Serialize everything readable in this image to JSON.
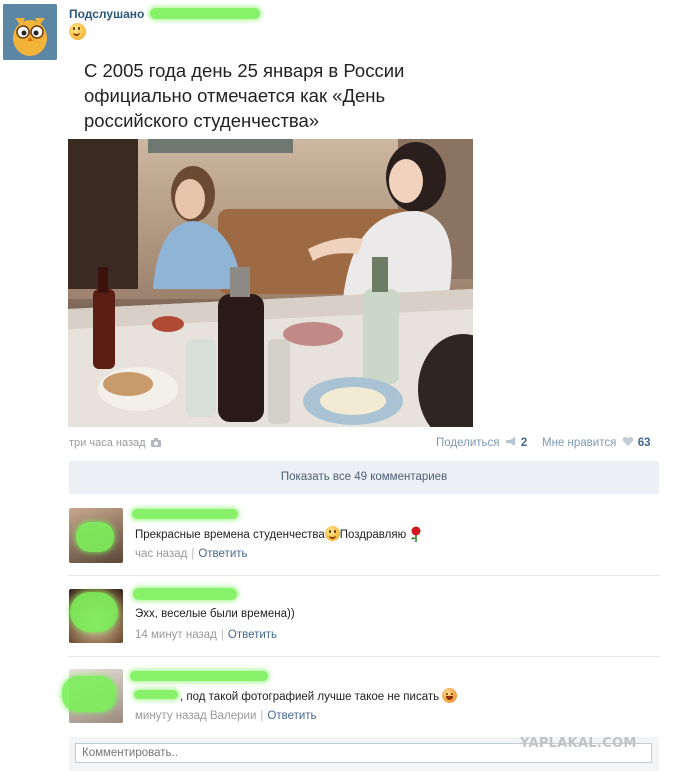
{
  "post": {
    "author": "Подслушано",
    "text_line1": "С 2005 года день 25 января в России",
    "text_line2": "официально отмечается как «День",
    "text_line3": "российского студенчества»",
    "time": "три часа назад",
    "share_label": "Поделиться",
    "share_count": "2",
    "like_label": "Мне нравится",
    "like_count": "63",
    "show_comments": "Показать все 49 комментариев"
  },
  "comments": [
    {
      "text": "Прекрасные времена студенчества",
      "text_after": "Поздравляю",
      "time": "час назад",
      "reply": "Ответить"
    },
    {
      "text": "Эхх, веселые были времена))",
      "time": "14 минут назад",
      "reply": "Ответить"
    },
    {
      "text": ", под такой фотографией лучше такое не писать",
      "time": "минуту назад Валерии",
      "reply": "Ответить"
    }
  ],
  "comment_input": {
    "placeholder": "Комментировать.."
  },
  "watermark": "YAPLAKAL.COM",
  "colors": {
    "link": "#2b587a",
    "accent": "#45688e",
    "muted": "#999999",
    "bar": "#eceff3",
    "censor": "#7cf05a"
  },
  "icons": [
    "smile-emoji-icon",
    "camera-icon",
    "megaphone-icon",
    "heart-icon",
    "rose-icon",
    "laughing-emoji-icon"
  ]
}
